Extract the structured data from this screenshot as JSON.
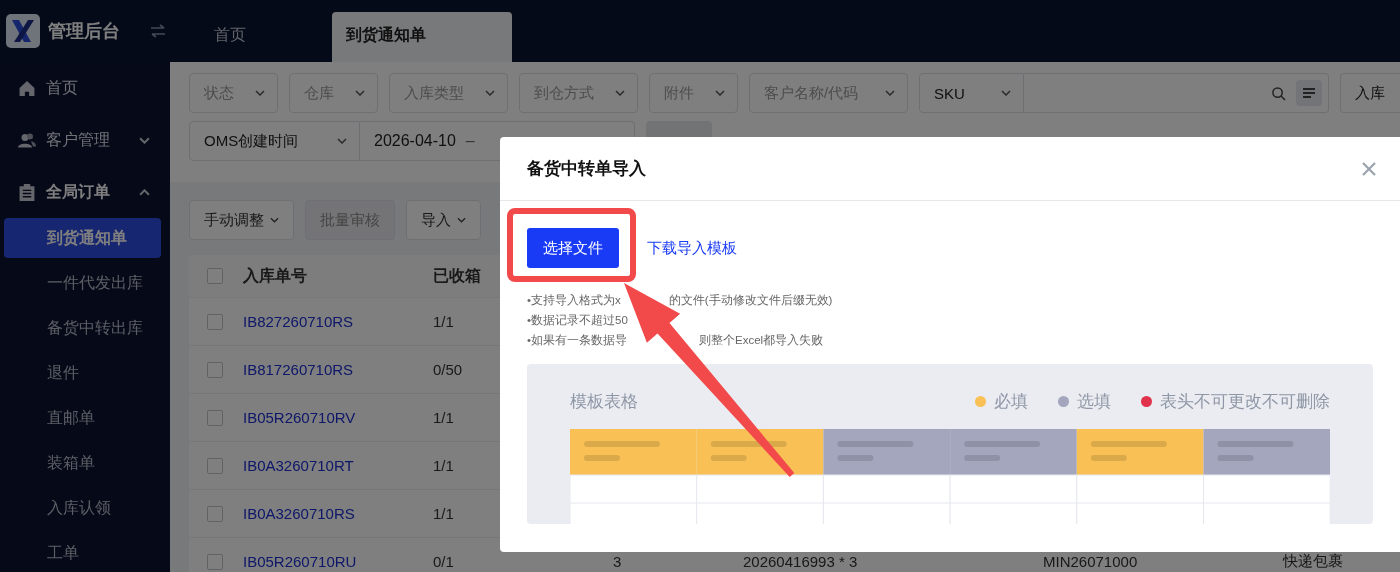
{
  "app": {
    "title": "管理后台"
  },
  "tabs": [
    {
      "label": "首页",
      "selected": false
    },
    {
      "label": "到货通知单",
      "selected": true
    }
  ],
  "sidebar": {
    "items": [
      {
        "label": "首页"
      },
      {
        "label": "客户管理",
        "expanded": false
      },
      {
        "label": "全局订单",
        "expanded": true,
        "children": [
          {
            "label": "到货通知单",
            "selected": true
          },
          {
            "label": "一件代发出库",
            "selected": false
          },
          {
            "label": "备货中转出库",
            "selected": false
          },
          {
            "label": "退件",
            "selected": false
          },
          {
            "label": "直邮单",
            "selected": false
          },
          {
            "label": "装箱单",
            "selected": false
          },
          {
            "label": "入库认领",
            "selected": false
          },
          {
            "label": "工单",
            "selected": false
          }
        ]
      }
    ]
  },
  "filters": {
    "row_1": [
      {
        "kind": "select",
        "placeholder": "状态"
      },
      {
        "kind": "select",
        "placeholder": "仓库"
      },
      {
        "kind": "select",
        "placeholder": "入库类型"
      },
      {
        "kind": "select",
        "placeholder": "到仓方式"
      },
      {
        "kind": "select",
        "placeholder": "附件"
      },
      {
        "kind": "select",
        "placeholder": "客户名称/代码"
      },
      {
        "kind": "search",
        "value": "SKU"
      },
      {
        "kind": "cut",
        "value": "入库"
      }
    ],
    "row_2": {
      "select": "OMS创建时间",
      "date_start": "2026-04-10",
      "separator": "–"
    }
  },
  "toolbar": [
    {
      "label": "手动调整",
      "dropdown": true,
      "disabled": false
    },
    {
      "label": "批量审核",
      "dropdown": false,
      "disabled": true
    },
    {
      "label": "导入",
      "dropdown": true,
      "disabled": false
    }
  ],
  "table": {
    "select_all_checked": false,
    "columns": [
      "入库单号",
      "已收箱"
    ],
    "rows": [
      {
        "checked": false,
        "order_no": "IB827260710RS",
        "boxes": "1/1",
        "extra": []
      },
      {
        "checked": false,
        "order_no": "IB817260710RS",
        "boxes": "0/50",
        "extra": []
      },
      {
        "checked": false,
        "order_no": "IB05R260710RV",
        "boxes": "1/1",
        "extra": []
      },
      {
        "checked": false,
        "order_no": "IB0A3260710RT",
        "boxes": "1/1",
        "extra": []
      },
      {
        "checked": false,
        "order_no": "IB0A3260710RS",
        "boxes": "1/1",
        "extra": []
      },
      {
        "checked": false,
        "order_no": "IB05R260710RU",
        "boxes": "0/1",
        "extra": [
          "3",
          "20260416993 * 3",
          "MIN26071000",
          "快递包裹"
        ]
      }
    ]
  },
  "modal": {
    "title": "备货中转单导入",
    "primary_button": "选择文件",
    "link": "下载导入模板",
    "notes": [
      [
        "•支持导入格式为x",
        "的文件(手动修改文件后缀无效)"
      ],
      [
        "•数据记录不超过50"
      ],
      [
        "•如果有一条数据导",
        "则整个Excel都导入失败"
      ]
    ],
    "template": {
      "title": "模板表格",
      "legend": [
        {
          "label": "必填",
          "color": "#f9c155"
        },
        {
          "label": "选填",
          "color": "#a3a6bd"
        },
        {
          "label": "表头不可更改不可删除",
          "color": "#e0324a"
        }
      ]
    }
  }
}
